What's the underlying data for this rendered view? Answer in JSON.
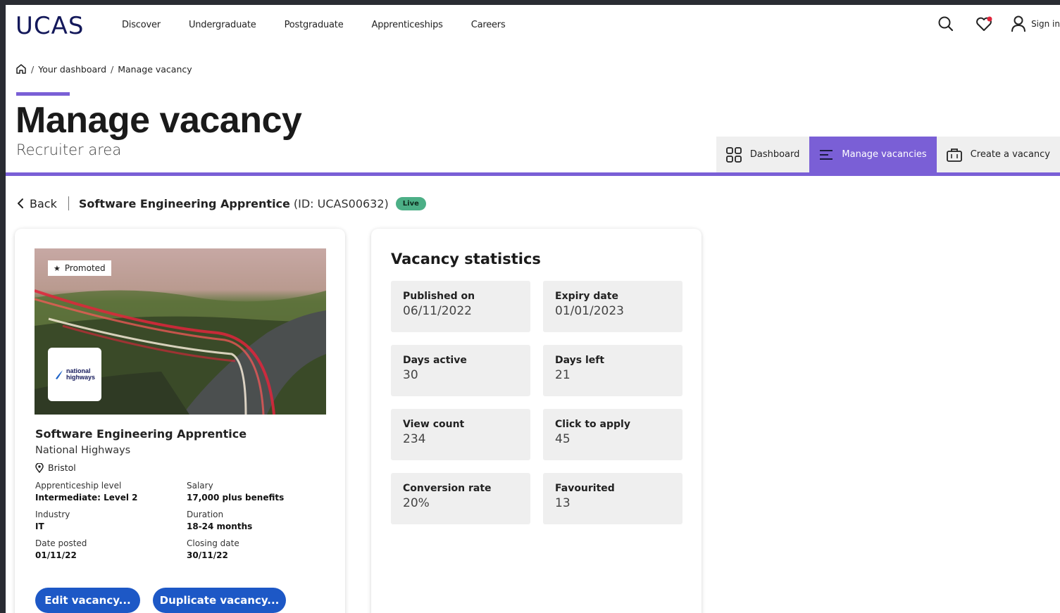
{
  "header": {
    "logo": "UCAS",
    "nav": [
      "Discover",
      "Undergraduate",
      "Postgraduate",
      "Apprenticeships",
      "Careers"
    ],
    "sign_in": "Sign in"
  },
  "breadcrumb": {
    "items": [
      "Your dashboard",
      "Manage vacancy"
    ]
  },
  "page": {
    "title": "Manage vacancy",
    "subtitle": "Recruiter area"
  },
  "tabs": [
    {
      "label": "Dashboard",
      "icon": "grid-icon"
    },
    {
      "label": "Manage vacancies",
      "icon": "list-icon",
      "active": true
    },
    {
      "label": "Create a vacancy",
      "icon": "briefcase-icon"
    }
  ],
  "vacancy": {
    "back_label": "Back",
    "title": "Software Engineering Apprentice",
    "id_text": "(ID: UCAS00632)",
    "status": "Live"
  },
  "card": {
    "promoted_label": "Promoted",
    "logo_text_1": "national",
    "logo_text_2": "highways",
    "job_title": "Software Engineering Apprentice",
    "organisation": "National Highways",
    "location": "Bristol",
    "meta": [
      {
        "label": "Apprenticeship level",
        "value": "Intermediate: Level 2"
      },
      {
        "label": "Salary",
        "value": "17,000 plus benefits"
      },
      {
        "label": "Industry",
        "value": "IT"
      },
      {
        "label": "Duration",
        "value": "18-24 months"
      },
      {
        "label": "Date posted",
        "value": "01/11/22"
      },
      {
        "label": "Closing date",
        "value": "30/11/22"
      }
    ],
    "edit_label": "Edit vacancy...",
    "duplicate_label": "Duplicate vacancy..."
  },
  "stats": {
    "title": "Vacancy statistics",
    "items": [
      {
        "label": "Published on",
        "value": "06/11/2022"
      },
      {
        "label": "Expiry date",
        "value": "01/01/2023"
      },
      {
        "label": "Days active",
        "value": "30"
      },
      {
        "label": "Days left",
        "value": "21"
      },
      {
        "label": "View count",
        "value": "234"
      },
      {
        "label": "Click to apply",
        "value": "45"
      },
      {
        "label": "Conversion rate",
        "value": "20%"
      },
      {
        "label": "Favourited",
        "value": "13"
      }
    ]
  },
  "colors": {
    "accent": "#7a5fd6",
    "primary_button": "#1d58c6",
    "live_badge": "#4caf86",
    "brand": "#13185a"
  }
}
